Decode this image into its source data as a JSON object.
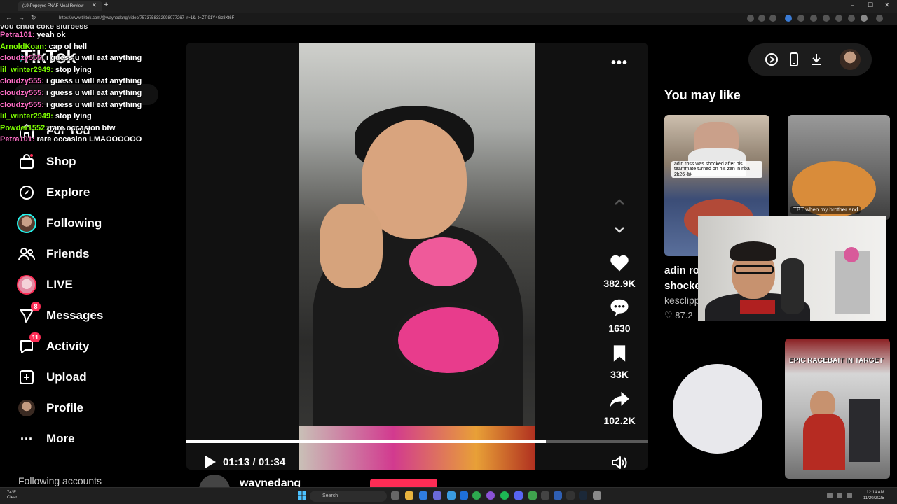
{
  "browser": {
    "tab_title": "(19)Popeyes FNAF Meal Review",
    "url": "https://www.tiktok.com/@waynedang/video/7573758332998077267_r=1&_t=ZT-91Y4Gz8Xt6F",
    "window_controls": {
      "minimize": "–",
      "maximize": "☐",
      "close": "✕"
    }
  },
  "stream_chat": {
    "top_partial": "you chug coke slurpess",
    "lines": [
      {
        "user": "Petra101:",
        "text": "yeah ok",
        "color": "#ff6ec7"
      },
      {
        "user": "ArnoldKoan:",
        "text": "cap of hell",
        "color": "#7cfc00"
      },
      {
        "user": "cloudzy555:",
        "text": "i guess u will eat anything",
        "color": "#ff6ec7"
      },
      {
        "user": "lil_winter2949:",
        "text": "stop lying",
        "color": "#7cfc00"
      },
      {
        "user": "cloudzy555:",
        "text": "i guess u will eat anything",
        "color": "#ff6ec7"
      },
      {
        "user": "cloudzy555:",
        "text": "i guess u will eat anything",
        "color": "#ff6ec7"
      },
      {
        "user": "cloudzy555:",
        "text": "i guess u will eat anything",
        "color": "#ff6ec7"
      },
      {
        "user": "lil_winter2949:",
        "text": "stop lying",
        "color": "#7cfc00"
      },
      {
        "user": "Powder1552:",
        "text": "rare occasion btw",
        "color": "#7cfc00"
      },
      {
        "user": "Petra101:",
        "text": "rare occasion LMAOOOOOO",
        "color": "#ff6ec7"
      }
    ]
  },
  "sidebar": {
    "logo": "TikTok",
    "items": [
      {
        "label": "For You",
        "icon": "home-icon"
      },
      {
        "label": "Shop",
        "icon": "shop-icon"
      },
      {
        "label": "Explore",
        "icon": "compass-icon"
      },
      {
        "label": "Following",
        "icon": "avatar-icon"
      },
      {
        "label": "Friends",
        "icon": "friends-icon"
      },
      {
        "label": "LIVE",
        "icon": "live-avatar-icon"
      },
      {
        "label": "Messages",
        "icon": "send-icon",
        "badge": "8"
      },
      {
        "label": "Activity",
        "icon": "activity-icon",
        "badge": "11"
      },
      {
        "label": "Upload",
        "icon": "plus-square-icon"
      },
      {
        "label": "Profile",
        "icon": "profile-avatar-icon"
      },
      {
        "label": "More",
        "icon": "more-dots-icon"
      }
    ],
    "following_accounts": "Following accounts"
  },
  "video": {
    "current_time": "01:13",
    "duration": "01:34",
    "time_display": "01:13 / 01:34",
    "progress": 0.78,
    "author": "waynedang"
  },
  "actions": {
    "likes": "382.9K",
    "comments": "1630",
    "saves": "33K",
    "shares": "102.2K"
  },
  "right": {
    "heading": "You may like",
    "cards": [
      {
        "caption": "adin ross was shocked after his teammate turned on his zen in nba 2k26 😂",
        "title_line1": "adin ro",
        "title_line2": "shocke",
        "author": "kesclipp",
        "likes": "87.2"
      },
      {
        "caption": "TBT when my brother and",
        "title_line1": "",
        "title_line2": ""
      },
      {
        "caption": ""
      },
      {
        "caption": "EPIC RAGEBAIT IN TARGET"
      }
    ]
  },
  "taskbar": {
    "weather_temp": "74°F",
    "weather_desc": "Clear",
    "search": "Search",
    "time": "12:14 AM",
    "date": "11/20/2025"
  },
  "colors": {
    "accent": "#fe2c55",
    "tiktok_cyan": "#25f4ee",
    "bg": "#000000"
  }
}
